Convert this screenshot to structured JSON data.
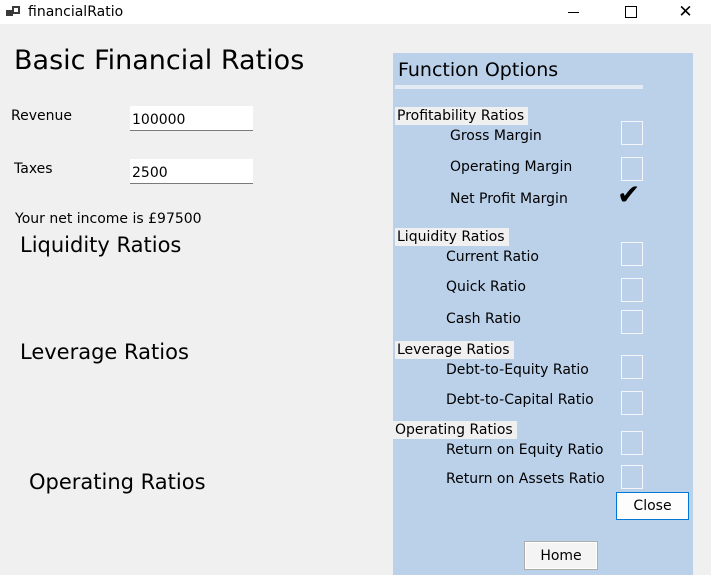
{
  "window": {
    "title": "financialRatio",
    "close_glyph": "✕"
  },
  "form": {
    "heading": "Basic Financial Ratios",
    "revenue": {
      "label": "Revenue",
      "value": "100000"
    },
    "taxes": {
      "label": "Taxes",
      "value": "2500"
    },
    "net_income_text": "Your net income is £97500",
    "sections": {
      "liquidity": "Liquidity Ratios",
      "leverage": "Leverage Ratios",
      "operating": "Operating Ratios"
    }
  },
  "panel": {
    "title": "Function Options",
    "groups": [
      {
        "label": "Profitability Ratios",
        "options": [
          {
            "label": "Gross Margin",
            "checked": false
          },
          {
            "label": "Operating Margin",
            "checked": false
          },
          {
            "label": "Net Profit Margin",
            "checked": true
          }
        ]
      },
      {
        "label": "Liquidity Ratios",
        "options": [
          {
            "label": "Current Ratio",
            "checked": false
          },
          {
            "label": "Quick Ratio",
            "checked": false
          },
          {
            "label": "Cash Ratio",
            "checked": false
          }
        ]
      },
      {
        "label": "Leverage Ratios",
        "options": [
          {
            "label": "Debt-to-Equity Ratio",
            "checked": false
          },
          {
            "label": "Debt-to-Capital Ratio",
            "checked": false
          }
        ]
      },
      {
        "label": "Operating Ratios",
        "options": [
          {
            "label": "Return on Equity Ratio",
            "checked": false
          },
          {
            "label": "Return on Assets Ratio",
            "checked": false
          }
        ]
      }
    ],
    "check_glyph": "✔",
    "close_label": "Close"
  },
  "home_label": "Home"
}
